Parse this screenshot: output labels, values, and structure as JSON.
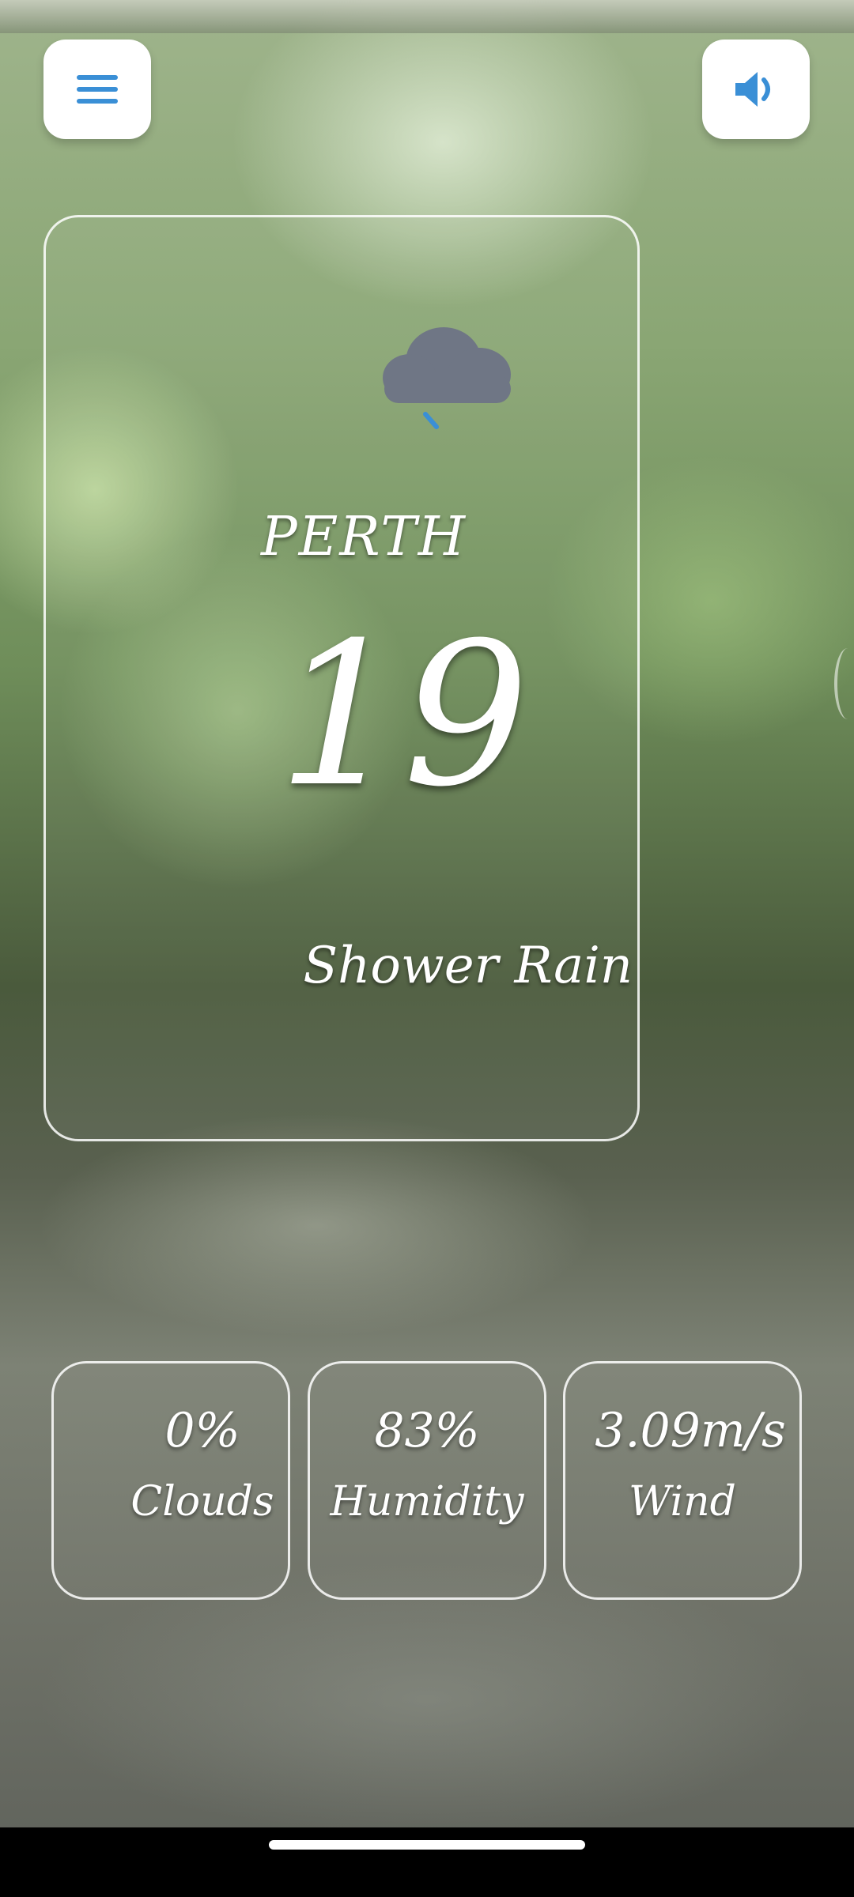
{
  "header": {
    "menu_icon": "hamburger-menu-icon",
    "sound_icon": "speaker-volume-icon",
    "accent_color": "#3a8fd6"
  },
  "weather": {
    "icon": "cloud-rain-icon",
    "city": "PERTH",
    "temperature": "19",
    "condition": "Shower Rain"
  },
  "stats": [
    {
      "value": "0%",
      "label": "Clouds"
    },
    {
      "value": "83%",
      "label": "Humidity"
    },
    {
      "value": "3.09m/s",
      "label": "Wind"
    }
  ]
}
